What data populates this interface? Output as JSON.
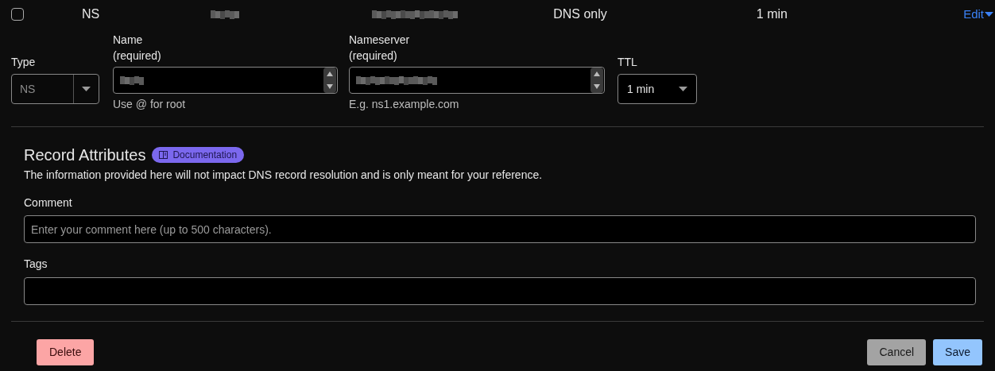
{
  "record_row": {
    "checked": false,
    "type": "NS",
    "proxy_status": "DNS only",
    "ttl": "1 min",
    "edit_link": "Edit"
  },
  "form": {
    "type": {
      "label": "Type",
      "value": "NS",
      "disabled": true
    },
    "name": {
      "label": "Name",
      "required": "(required)",
      "help": "Use @ for root"
    },
    "nameserver": {
      "label": "Nameserver",
      "required": "(required)",
      "help": "E.g. ns1.example.com"
    },
    "ttl": {
      "label": "TTL",
      "value": "1 min"
    }
  },
  "attributes": {
    "title": "Record Attributes",
    "doc_badge": "Documentation",
    "description": "The information provided here will not impact DNS record resolution and is only meant for your reference.",
    "comment": {
      "label": "Comment",
      "placeholder": "Enter your comment here (up to 500 characters)."
    },
    "tags": {
      "label": "Tags"
    }
  },
  "actions": {
    "delete": "Delete",
    "cancel": "Cancel",
    "save": "Save"
  }
}
